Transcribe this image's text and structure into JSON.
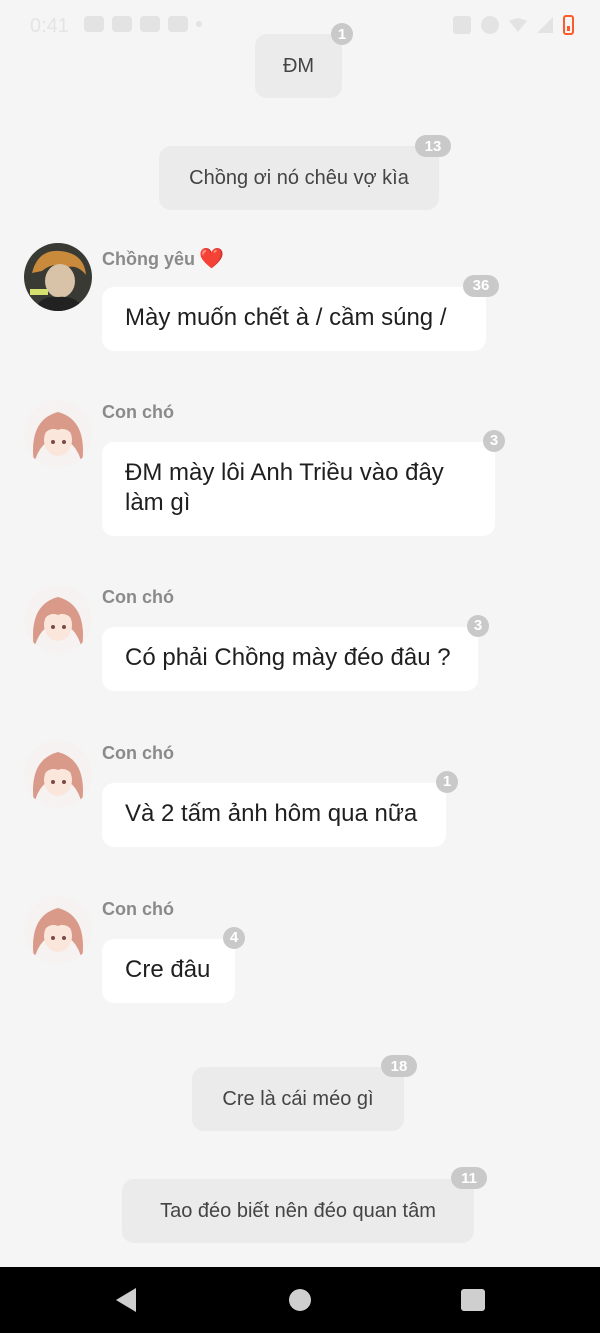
{
  "status_bar": {
    "time": "0:41"
  },
  "messages": [
    {
      "type": "center",
      "text": "ĐM",
      "badge": "1"
    },
    {
      "type": "center",
      "text": "Chồng ơi nó chêu vợ kìa",
      "badge": "13"
    },
    {
      "type": "user",
      "sender": "Chồng yêu",
      "sender_emoji": "❤️",
      "avatar": "boy-avatar",
      "text": "Mày muốn chết à / cầm súng /",
      "badge": "36"
    },
    {
      "type": "user",
      "sender": "Con chó",
      "avatar": "girl-avatar",
      "text": "ĐM mày lôi Anh Triều vào đây làm gì",
      "badge": "3"
    },
    {
      "type": "user",
      "sender": "Con chó",
      "avatar": "girl-avatar",
      "text": "Có phải Chồng mày đéo đâu ?",
      "badge": "3"
    },
    {
      "type": "user",
      "sender": "Con chó",
      "avatar": "girl-avatar",
      "text": "Và 2 tấm ảnh hôm qua nữa",
      "badge": "1"
    },
    {
      "type": "user",
      "sender": "Con chó",
      "avatar": "girl-avatar",
      "text": "Cre đâu",
      "badge": "4"
    },
    {
      "type": "center",
      "text": "Cre là cái méo gì",
      "badge": "18"
    },
    {
      "type": "center",
      "text": "Tao đéo biết nên đéo quan tâm",
      "badge": "11"
    }
  ],
  "nav_bar": {
    "icons": [
      "back-icon",
      "home-icon",
      "recent-apps-icon"
    ]
  },
  "colors": {
    "background": "#f5f5f5",
    "bubble_user": "#ffffff",
    "bubble_center": "#ebebeb",
    "badge": "#c9c9c9",
    "battery": "#ff5a2a"
  }
}
